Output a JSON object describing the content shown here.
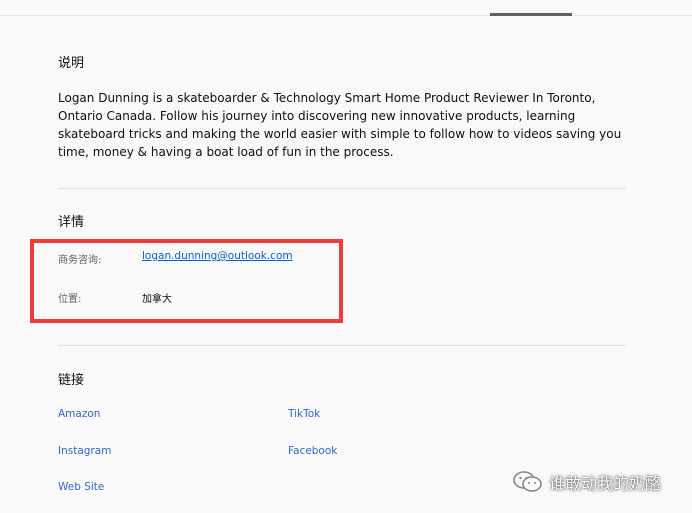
{
  "colors": {
    "link": "#065fd4",
    "highlight": "#ee3b3b",
    "text": "#0f0f0f",
    "muted": "#606060"
  },
  "description": {
    "heading": "说明",
    "text": "Logan Dunning is a skateboarder & Technology Smart Home Product Reviewer In Toronto, Ontario Canada.  Follow his journey into discovering new innovative products, learning skateboard tricks and making the world easier with simple to follow how to videos saving you time, money & having a boat load of fun in the process."
  },
  "details": {
    "heading": "详情",
    "business_label": "商务咨询:",
    "business_email": "logan.dunning@outlook.com",
    "location_label": "位置:",
    "location_value": "加拿大"
  },
  "links": {
    "heading": "链接",
    "items": [
      "Amazon",
      "TikTok",
      "Instagram",
      "Facebook",
      "Web Site"
    ]
  },
  "watermark": {
    "text": "谁敢动我的奶酪",
    "icon": "wechat-icon"
  }
}
